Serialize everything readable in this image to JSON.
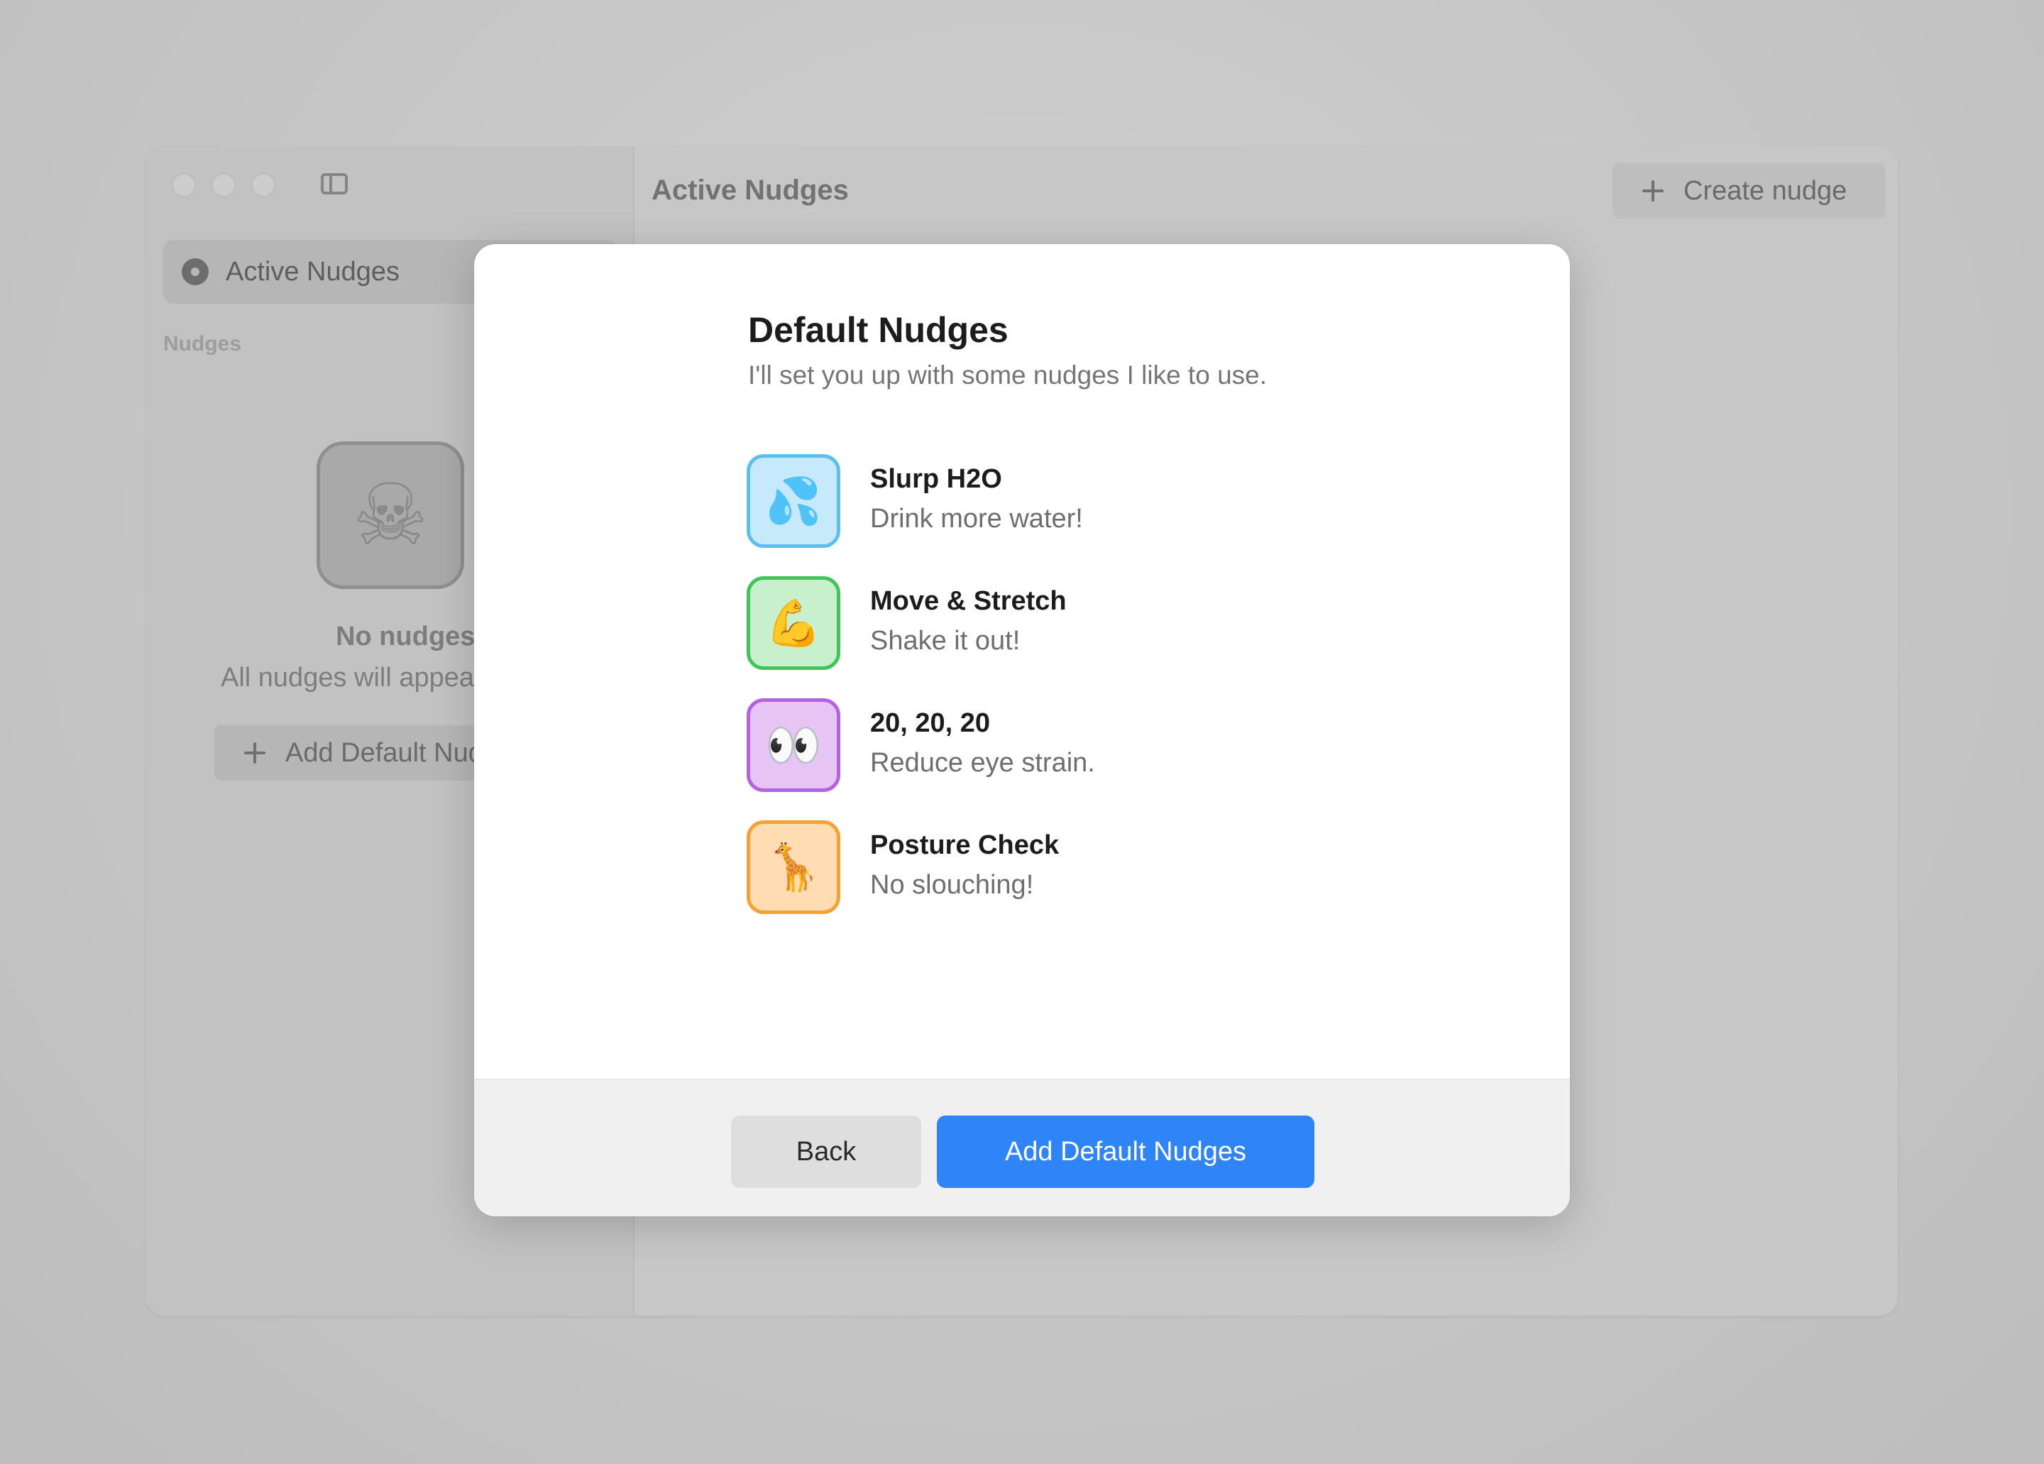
{
  "background_window": {
    "sidebar": {
      "active_item_label": "Active Nudges",
      "section_label": "Nudges",
      "empty_state": {
        "icon": "skull-crossbones-icon",
        "title": "No nudges yet",
        "subtitle": "All nudges will appear here",
        "add_button_label": "Add Default Nudges"
      }
    },
    "header": {
      "title": "Active Nudges",
      "create_button_label": "Create nudge"
    }
  },
  "modal": {
    "title": "Default Nudges",
    "subtitle": "I'll set you up with some nudges I like to use.",
    "nudges": [
      {
        "name": "Slurp H2O",
        "description": "Drink more water!",
        "icon": "sweat-droplets-icon",
        "icon_glyph": "💦",
        "bg_color": "#c6e9fb",
        "border_color": "#5cbff0"
      },
      {
        "name": "Move & Stretch",
        "description": "Shake it out!",
        "icon": "flexed-biceps-icon",
        "icon_glyph": "💪",
        "bg_color": "#c9f0cd",
        "border_color": "#3fc558"
      },
      {
        "name": "20, 20, 20",
        "description": "Reduce eye strain.",
        "icon": "eyes-icon",
        "icon_glyph": "👀",
        "bg_color": "#e6c4f4",
        "border_color": "#b362e0"
      },
      {
        "name": "Posture Check",
        "description": "No slouching!",
        "icon": "giraffe-icon",
        "icon_glyph": "🦒",
        "bg_color": "#ffdcb2",
        "border_color": "#f8a033"
      }
    ],
    "buttons": {
      "back_label": "Back",
      "primary_label": "Add Default Nudges"
    },
    "accent_color": "#2f84f8"
  }
}
